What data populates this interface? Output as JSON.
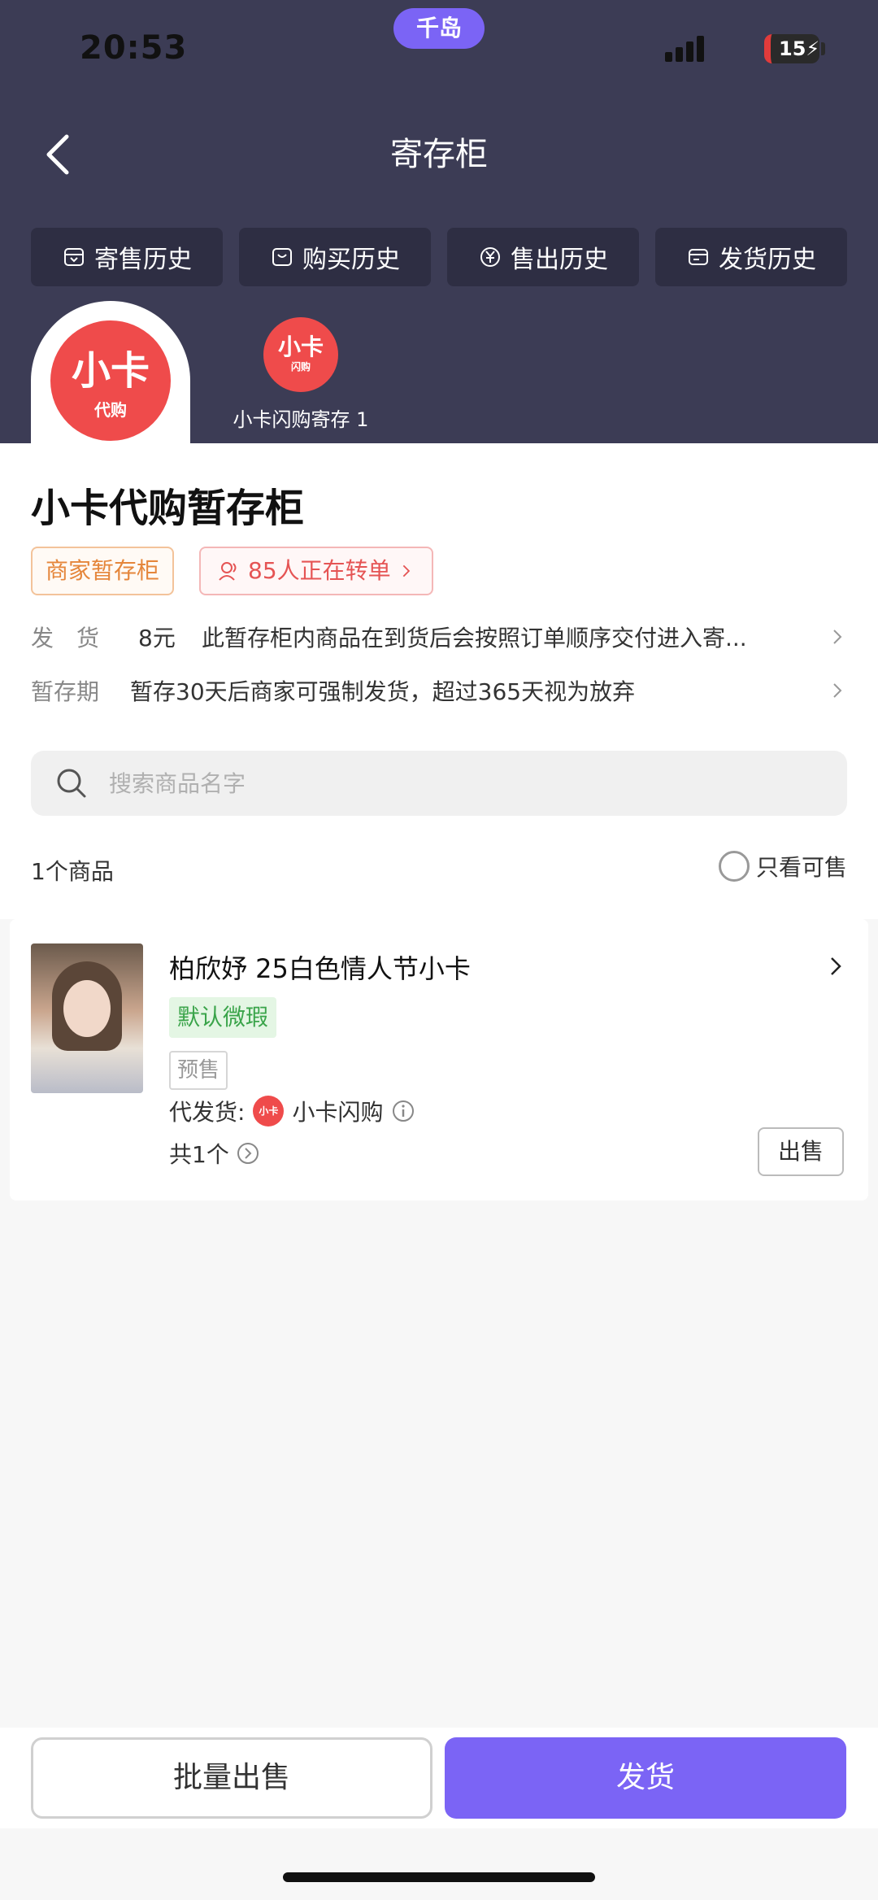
{
  "status": {
    "time": "20:53",
    "island_label": "千岛",
    "battery": "15"
  },
  "nav": {
    "title": "寄存柜"
  },
  "history_tabs": [
    {
      "label": "寄售历史",
      "icon": "box-out-icon"
    },
    {
      "label": "购买历史",
      "icon": "bag-icon"
    },
    {
      "label": "售出历史",
      "icon": "yen-icon"
    },
    {
      "label": "发货历史",
      "icon": "card-icon"
    }
  ],
  "store": {
    "logo_main": "小卡",
    "logo_sub": "代购",
    "chip_logo_main": "小卡",
    "chip_logo_sub": "闪购",
    "chip_label": "小卡闪购寄存  1",
    "title": "小卡代购暂存柜",
    "tag_merchant": "商家暂存柜",
    "tag_transfer": "85人正在转单"
  },
  "info": {
    "ship_label": "发　货",
    "ship_fee": "8元",
    "ship_desc": "此暂存柜内商品在到货后会按照订单顺序交付进入寄...",
    "period_label": "暂存期",
    "period_desc": "暂存30天后商家可强制发货，超过365天视为放弃"
  },
  "search": {
    "placeholder": "搜索商品名字"
  },
  "list": {
    "count_label": "1个商品",
    "only_sale_label": "只看可售"
  },
  "product": {
    "name": "柏欣妤 25白色情人节小卡",
    "tag_defect": "默认微瑕",
    "tag_presale": "预售",
    "ship_by_label": "代发货:",
    "ship_by_logo": "小卡",
    "ship_by_name": "小卡闪购",
    "qty_label": "共1个",
    "sell_label": "出售"
  },
  "bottom": {
    "bulk_label": "批量出售",
    "ship_label": "发货"
  },
  "colors": {
    "header": "#3c3c55",
    "accent": "#7b64f5",
    "brand_red": "#ef4b4b"
  }
}
